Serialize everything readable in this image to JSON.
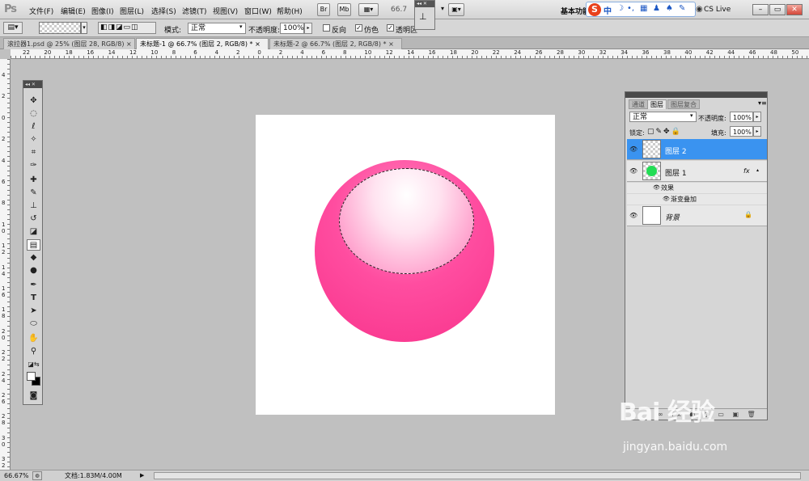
{
  "app": {
    "logo": "Ps"
  },
  "menu": {
    "items": [
      "文件(F)",
      "编辑(E)",
      "图像(I)",
      "图层(L)",
      "选择(S)",
      "滤镜(T)",
      "视图(V)",
      "窗口(W)",
      "帮助(H)"
    ],
    "btn_br": "Br",
    "btn_mb": "Mb",
    "zoom": "66.7",
    "workspace": "基本功能",
    "ime_s": "S",
    "ime_zh": "中",
    "cslive": "CS Live",
    "min": "–",
    "max": "▭",
    "close": "✕"
  },
  "options": {
    "mode_label": "模式:",
    "mode_value": "正常",
    "opacity_label": "不透明度:",
    "opacity_value": "100%",
    "reverse": "反向",
    "dither": "仿色",
    "transparency": "透明区"
  },
  "tabs": [
    {
      "label": "滚拉器1.psd @ 25% (图层 28, RGB/8) ×",
      "active": false
    },
    {
      "label": "未标题-1 @ 66.7% (图层 2, RGB/8) * ×",
      "active": true
    },
    {
      "label": "未标题-2 @ 66.7% (图层 2, RGB/8) * ×",
      "active": false
    }
  ],
  "ruler_top": [
    "22",
    "20",
    "18",
    "16",
    "14",
    "12",
    "10",
    "8",
    "6",
    "4",
    "2",
    "0",
    "2",
    "4",
    "6",
    "8",
    "10",
    "12",
    "14",
    "16",
    "18",
    "20",
    "22",
    "24",
    "26",
    "28",
    "30",
    "32",
    "34",
    "36",
    "38",
    "40",
    "42",
    "44",
    "46",
    "48",
    "50"
  ],
  "ruler_left": [
    "4",
    "2",
    "0",
    "2",
    "4",
    "6",
    "8",
    "1 0",
    "1 2",
    "1 4",
    "1 6",
    "1 8",
    "2 0",
    "2 2",
    "2 4",
    "2 6",
    "2 8",
    "3 0",
    "3 2"
  ],
  "layers": {
    "tabs": [
      "通道",
      "图层",
      "图层复合"
    ],
    "blend_mode": "正常",
    "opacity_label": "不透明度:",
    "opacity_value": "100%",
    "lock_label": "锁定:",
    "fill_label": "填充:",
    "fill_value": "100%",
    "items": [
      {
        "name": "图层 2",
        "selected": true
      },
      {
        "name": "图层 1",
        "fx": "fx"
      },
      {
        "name": "背景"
      }
    ],
    "effects_label": "效果",
    "gradient_overlay": "渐变叠加"
  },
  "status": {
    "zoom": "66.67%",
    "doc": "文档:1.83M/4.00M"
  },
  "watermark": {
    "brand": "Bai 经验",
    "url": "jingyan.baidu.com"
  },
  "colors": {
    "ball": "#f8338b",
    "ball_light": "#ff8fc5",
    "selected_layer": "#3a93f0",
    "layer1_thumb": "#22dd55"
  }
}
